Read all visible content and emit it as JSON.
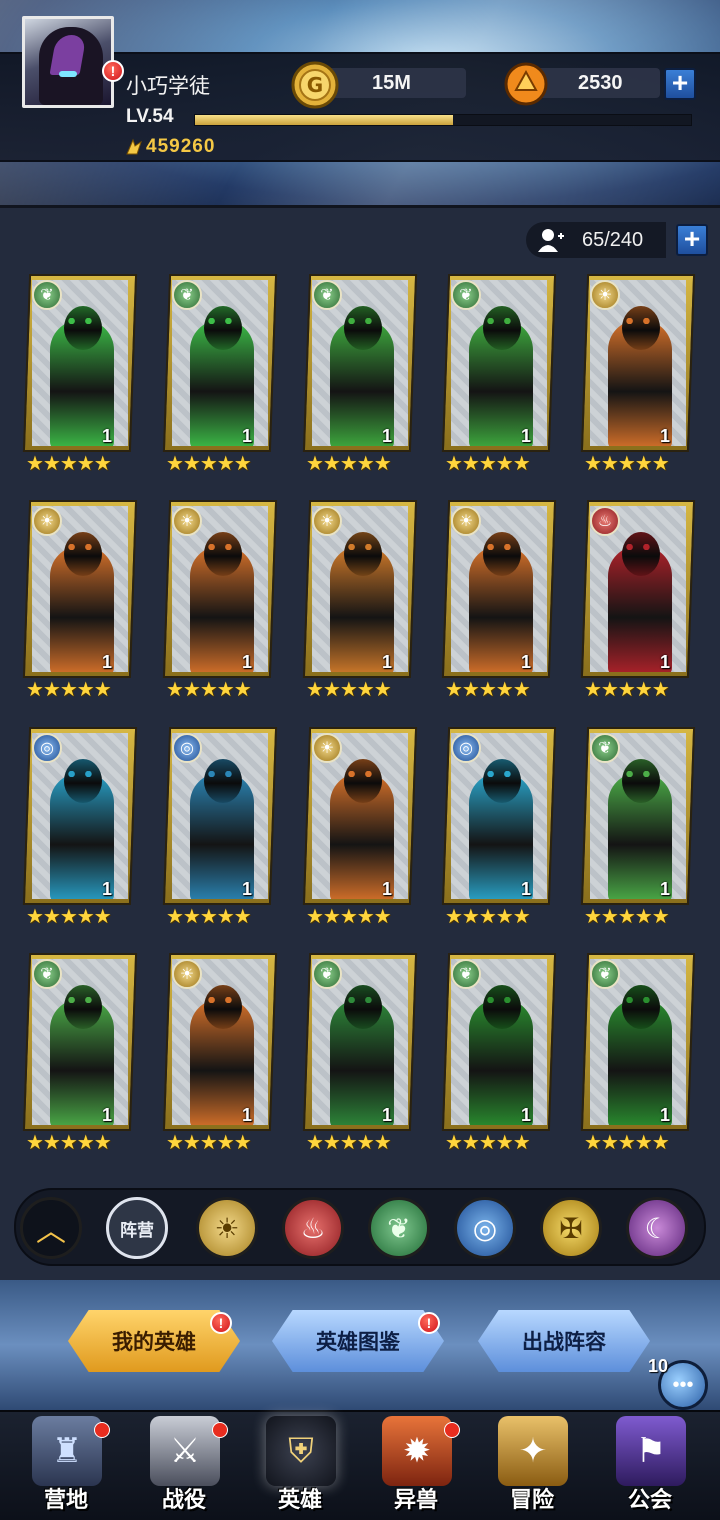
{
  "player": {
    "name": "小巧学徒",
    "level": "LV.54",
    "xp_fraction": 0.52,
    "power": "459260"
  },
  "resources": {
    "gold": "15M",
    "gems": "2530"
  },
  "roster": {
    "capacity": "65/240"
  },
  "heroes": [
    {
      "faction": "nature",
      "level": "1",
      "stars": "★★★★★",
      "color": "#3dbf48"
    },
    {
      "faction": "nature",
      "level": "1",
      "stars": "★★★★★",
      "color": "#3dbf48"
    },
    {
      "faction": "nature",
      "level": "1",
      "stars": "★★★★★",
      "color": "#3fae3f"
    },
    {
      "faction": "nature",
      "level": "1",
      "stars": "★★★★★",
      "color": "#3fae3f"
    },
    {
      "faction": "light",
      "level": "1",
      "stars": "★★★★★",
      "color": "#d8722a"
    },
    {
      "faction": "light",
      "level": "1",
      "stars": "★★★★★",
      "color": "#d8722a"
    },
    {
      "faction": "light",
      "level": "1",
      "stars": "★★★★★",
      "color": "#d8722a"
    },
    {
      "faction": "light",
      "level": "1",
      "stars": "★★★★★",
      "color": "#d27b2a"
    },
    {
      "faction": "light",
      "level": "1",
      "stars": "★★★★★",
      "color": "#d8722a"
    },
    {
      "faction": "fire",
      "level": "1",
      "stars": "★★★★★",
      "color": "#b0222a"
    },
    {
      "faction": "water",
      "level": "1",
      "stars": "★★★★★",
      "color": "#28a0c8"
    },
    {
      "faction": "water",
      "level": "1",
      "stars": "★★★★★",
      "color": "#2b86b6"
    },
    {
      "faction": "light",
      "level": "1",
      "stars": "★★★★★",
      "color": "#d8722a"
    },
    {
      "faction": "water",
      "level": "1",
      "stars": "★★★★★",
      "color": "#2aa6cc"
    },
    {
      "faction": "nature",
      "level": "1",
      "stars": "★★★★★",
      "color": "#4cae48"
    },
    {
      "faction": "nature",
      "level": "1",
      "stars": "★★★★★",
      "color": "#4cae48"
    },
    {
      "faction": "light",
      "level": "1",
      "stars": "★★★★★",
      "color": "#d8722a"
    },
    {
      "faction": "nature",
      "level": "1",
      "stars": "★★★★★",
      "color": "#2e8a3a"
    },
    {
      "faction": "nature",
      "level": "1",
      "stars": "★★★★★",
      "color": "#2a8f2f"
    },
    {
      "faction": "nature",
      "level": "1",
      "stars": "★★★★★",
      "color": "#2a8f2f"
    }
  ],
  "filters": {
    "all_label": "阵营",
    "factions": [
      "light",
      "fire",
      "nature",
      "water",
      "holy",
      "shadow"
    ]
  },
  "actions": {
    "my_heroes": "我的英雄",
    "codex": "英雄图鉴",
    "lineup": "出战阵容"
  },
  "chat": {
    "count": "10"
  },
  "nav": {
    "camp": "营地",
    "campaign": "战役",
    "heroes": "英雄",
    "beasts": "异兽",
    "adventure": "冒险",
    "guild": "公会"
  },
  "icons": {
    "nature": "leaf-icon",
    "light": "sun-icon",
    "fire": "flame-icon",
    "water": "wave-icon",
    "holy": "holy-icon",
    "shadow": "shadow-icon"
  }
}
